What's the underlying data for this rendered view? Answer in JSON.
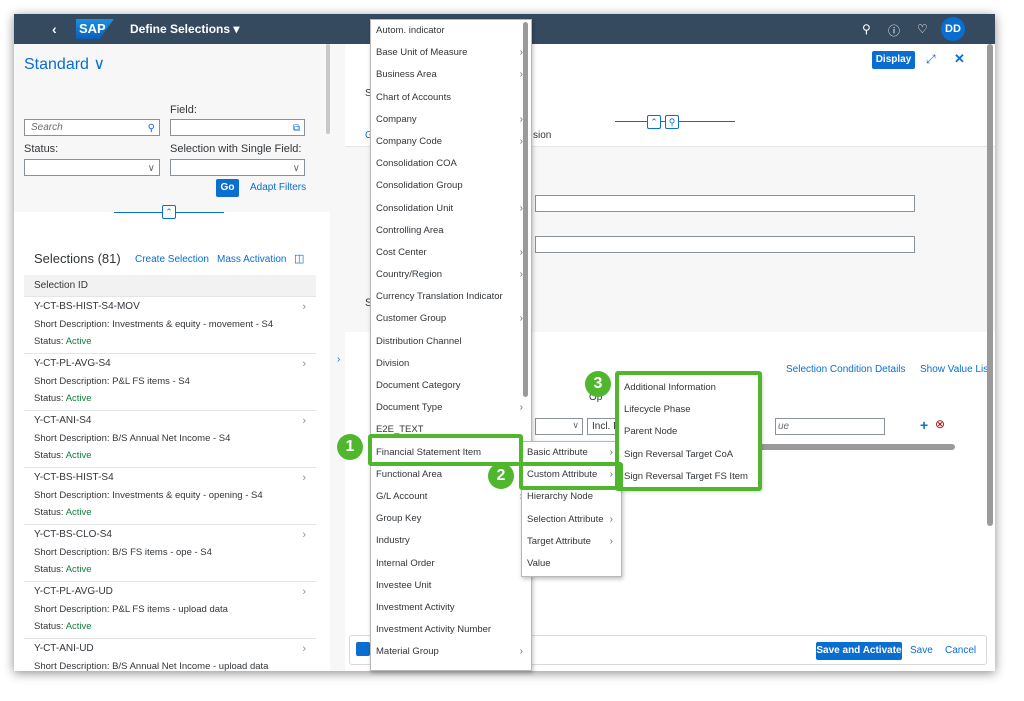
{
  "shell": {
    "logo": "SAP",
    "title": "Define Selections ▾",
    "avatar": "DD"
  },
  "left": {
    "variant": "Standard ∨",
    "field_label": "Field:",
    "search_placeholder": "Search",
    "status_label": "Status:",
    "single_field_label": "Selection with Single Field:",
    "go": "Go",
    "adapt_filters": "Adapt Filters",
    "selections_title": "Selections (81)",
    "create_selection": "Create Selection",
    "mass_activation": "Mass Activation",
    "column_header": "Selection ID",
    "rows": [
      {
        "id": "Y-CT-BS-HIST-S4-MOV",
        "desc": "Short Description:  Investments & equity - movement - S4",
        "status_label": "Status:  ",
        "status": "Active"
      },
      {
        "id": "Y-CT-PL-AVG-S4",
        "desc": "Short Description:  P&L FS items - S4",
        "status_label": "Status:  ",
        "status": "Active"
      },
      {
        "id": "Y-CT-ANI-S4",
        "desc": "Short Description:  B/S Annual Net Income - S4",
        "status_label": "Status:  ",
        "status": "Active"
      },
      {
        "id": "Y-CT-BS-HIST-S4",
        "desc": "Short Description:  Investments & equity - opening - S4",
        "status_label": "Status:  ",
        "status": "Active"
      },
      {
        "id": "Y-CT-BS-CLO-S4",
        "desc": "Short Description:  B/S FS items - ope - S4",
        "status_label": "Status:  ",
        "status": "Active"
      },
      {
        "id": "Y-CT-PL-AVG-UD",
        "desc": "Short Description:  P&L FS items - upload data",
        "status_label": "Status:  ",
        "status": "Active"
      },
      {
        "id": "Y-CT-ANI-UD",
        "desc": "Short Description:  B/S Annual Net Income - upload data",
        "status_label": "",
        "status": ""
      }
    ]
  },
  "right": {
    "display": "Display",
    "s_char": "S",
    "g_char": "G",
    "tab_partial": "sion",
    "s_char2": "S",
    "selection_condition_details": "Selection Condition Details",
    "show_value_list": "Show Value List",
    "op_partial": "Op",
    "incl_eq": "Incl. Equ",
    "value_partial": "ue",
    "save_and_activate": "Save and Activate",
    "save": "Save",
    "cancel": "Cancel"
  },
  "menu1": {
    "items": [
      {
        "label": "Autom. indicator",
        "sub": false
      },
      {
        "label": "Base Unit of Measure",
        "sub": true
      },
      {
        "label": "Business Area",
        "sub": true
      },
      {
        "label": "Chart of Accounts",
        "sub": false
      },
      {
        "label": "Company",
        "sub": true
      },
      {
        "label": "Company Code",
        "sub": true
      },
      {
        "label": "Consolidation COA",
        "sub": false
      },
      {
        "label": "Consolidation Group",
        "sub": false
      },
      {
        "label": "Consolidation Unit",
        "sub": true
      },
      {
        "label": "Controlling Area",
        "sub": false
      },
      {
        "label": "Cost Center",
        "sub": true
      },
      {
        "label": "Country/Region",
        "sub": true
      },
      {
        "label": "Currency Translation Indicator",
        "sub": false
      },
      {
        "label": "Customer Group",
        "sub": true
      },
      {
        "label": "Distribution Channel",
        "sub": false
      },
      {
        "label": "Division",
        "sub": false
      },
      {
        "label": "Document Category",
        "sub": false
      },
      {
        "label": "Document Type",
        "sub": true
      },
      {
        "label": "E2E_TEXT",
        "sub": false
      },
      {
        "label": "Financial Statement Item",
        "sub": true
      },
      {
        "label": "Functional Area",
        "sub": false
      },
      {
        "label": "G/L Account",
        "sub": true
      },
      {
        "label": "Group Key",
        "sub": false
      },
      {
        "label": "Industry",
        "sub": false
      },
      {
        "label": "Internal Order",
        "sub": false
      },
      {
        "label": "Investee Unit",
        "sub": false
      },
      {
        "label": "Investment Activity",
        "sub": false
      },
      {
        "label": "Investment Activity Number",
        "sub": false
      },
      {
        "label": "Material Group",
        "sub": true
      }
    ]
  },
  "menu2": {
    "items": [
      {
        "label": "Basic Attribute",
        "sub": true
      },
      {
        "label": "Custom Attribute",
        "sub": true
      },
      {
        "label": "Hierarchy Node",
        "sub": false
      },
      {
        "label": "Selection Attribute",
        "sub": true
      },
      {
        "label": "Target Attribute",
        "sub": true
      },
      {
        "label": "Value",
        "sub": false
      }
    ]
  },
  "menu3": {
    "items": [
      {
        "label": "Additional Information"
      },
      {
        "label": "Lifecycle Phase"
      },
      {
        "label": "Parent Node"
      },
      {
        "label": "Sign Reversal Target CoA"
      },
      {
        "label": "Sign Reversal Target FS Item"
      }
    ]
  },
  "badges": [
    "1",
    "2",
    "3"
  ],
  "colors": {
    "shell": "#354a5f",
    "accent": "#0a6ed1",
    "highlight": "#4fb62e",
    "active": "#107e3e"
  }
}
